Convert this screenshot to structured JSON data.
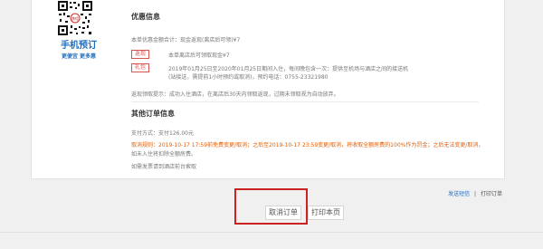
{
  "qr": {
    "label": "手机预订",
    "sub": "更便宜  更多惠",
    "badge": "携程"
  },
  "section1": {
    "title": "优惠信息",
    "row1": "本单优惠金额合计：现金返现(离店后可领)¥7",
    "row2_tag": "返现",
    "row2_text": "本单离店后可领取现金¥7",
    "row3_tag": "礼包",
    "row3_line1": "2019年01月25日至2020年01月25日期间入住，每间晚包含一次：提供至机场与酒店之间的接送机",
    "row3_line2": "(站接送，需提前1小时预约或取消)，预约电话：0755-23321980",
    "row4": "返现领取提示：成功入住酒店，在离店后30天内领取返现，过期未领取视为自动放弃。"
  },
  "section2": {
    "title": "其他订单信息",
    "pay_method": "支付方式：支付126.00元",
    "cancel_line1": "取消规则：2019-10-17 17:59前免费变更/取消；之后至2019-10-17 23:59变更/取消，将收取全额房费的100%作为罚金；之后无法变更/取消，",
    "cancel_line2": "如未入住将扣除全额房费。",
    "invoice": "如需发票请到酒店前台索取"
  },
  "links": {
    "send_sms": "发送短信",
    "separator": "|",
    "print_order": "打印订单"
  },
  "buttons": {
    "cancel_order": "取消订单",
    "print_page": "打印本页"
  }
}
